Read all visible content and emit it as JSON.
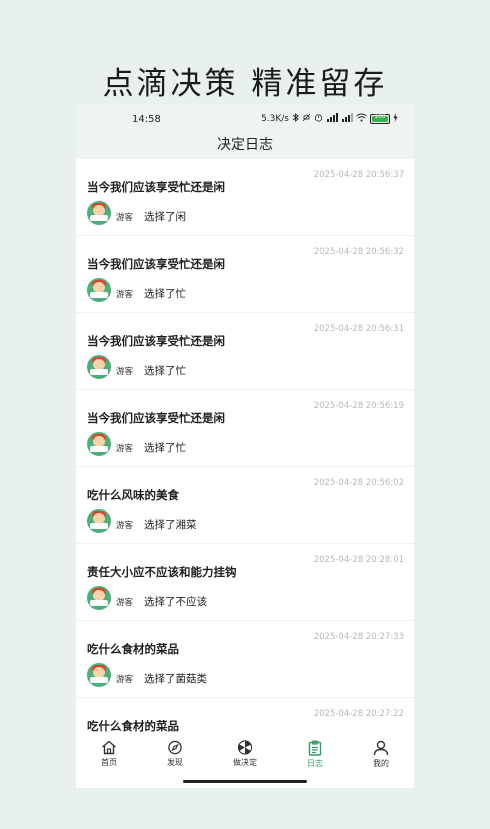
{
  "headline": "点滴决策 精准留存",
  "status_bar": {
    "time": "14:58",
    "net_speed": "5.3K/s",
    "battery": "100",
    "battery_level": 1.0
  },
  "page": {
    "title": "决定日志"
  },
  "log_items": [
    {
      "question": "当今我们应该享受忙还是闲",
      "time": "2025-04-28 20:56:37",
      "user": "游客",
      "choice": "选择了闲"
    },
    {
      "question": "当今我们应该享受忙还是闲",
      "time": "2025-04-28 20:56:32",
      "user": "游客",
      "choice": "选择了忙"
    },
    {
      "question": "当今我们应该享受忙还是闲",
      "time": "2025-04-28 20:56:31",
      "user": "游客",
      "choice": "选择了忙"
    },
    {
      "question": "当今我们应该享受忙还是闲",
      "time": "2025-04-28 20:56:19",
      "user": "游客",
      "choice": "选择了忙"
    },
    {
      "question": "吃什么风味的美食",
      "time": "2025-04-28 20:56:02",
      "user": "游客",
      "choice": "选择了湘菜"
    },
    {
      "question": "责任大小应不应该和能力挂钩",
      "time": "2025-04-28 20:28:01",
      "user": "游客",
      "choice": "选择了不应该"
    },
    {
      "question": "吃什么食材的菜品",
      "time": "2025-04-28 20:27:33",
      "user": "游客",
      "choice": "选择了菌菇类"
    },
    {
      "question": "吃什么食材的菜品",
      "time": "2025-04-28 20:27:22",
      "user": "",
      "choice": ""
    }
  ],
  "tabbar": {
    "items": [
      {
        "label": "首页",
        "icon": "home-icon"
      },
      {
        "label": "发现",
        "icon": "compass-icon"
      },
      {
        "label": "做决定",
        "icon": "pinwheel-icon"
      },
      {
        "label": "日志",
        "icon": "clipboard-icon"
      },
      {
        "label": "我的",
        "icon": "person-icon"
      }
    ],
    "active_index": 3,
    "active_color": "#2f9c63"
  }
}
